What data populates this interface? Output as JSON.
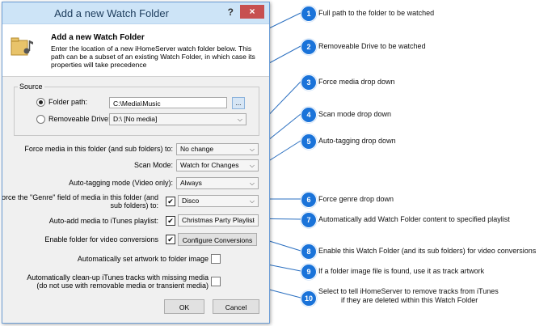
{
  "dialog": {
    "title": "Add a new Watch Folder",
    "help": "?",
    "close": "×",
    "header": {
      "title": "Add a new Watch Folder",
      "description": "Enter the location of a new iHomeServer watch folder below.  This path can be a subset of an existing Watch Folder, in which case its properties will take precedence"
    },
    "source": {
      "group_label": "Source",
      "folder_label": "Folder path:",
      "folder_value": "C:\\Media\\Music",
      "browse_label": "...",
      "removable_label": "Removeable Drive:",
      "removable_value": "D:\\ [No media]"
    },
    "force_media": {
      "label": "Force media in this folder (and sub folders) to:",
      "value": "No change"
    },
    "scan_mode": {
      "label": "Scan Mode:",
      "value": "Watch for Changes"
    },
    "autotag": {
      "label": "Auto-tagging mode (Video only):",
      "value": "Always"
    },
    "genre": {
      "label_line1": "Force the \"Genre\" field of media in this folder (and",
      "label_line2": "sub folders) to:",
      "value": "Disco"
    },
    "playlist": {
      "label": "Auto-add media to iTunes playlist:",
      "value": "Christmas Party Playlist"
    },
    "video": {
      "label": "Enable folder for video conversions",
      "button": "Configure Conversions"
    },
    "artwork": {
      "label": "Automatically set artwork to folder image"
    },
    "cleanup": {
      "label_line1": "Automatically clean-up iTunes tracks with missing media",
      "label_line2": "(do not use with removable media or transient media)"
    },
    "ok": "OK",
    "cancel": "Cancel"
  },
  "callouts": [
    {
      "num": "1",
      "text": "Full path to the folder to be watched"
    },
    {
      "num": "2",
      "text": "Removeable Drive to be watched"
    },
    {
      "num": "3",
      "text": "Force media drop down"
    },
    {
      "num": "4",
      "text": "Scan mode drop down"
    },
    {
      "num": "5",
      "text": "Auto-tagging drop down"
    },
    {
      "num": "6",
      "text": "Force genre drop down"
    },
    {
      "num": "7",
      "text": "Automatically add Watch Folder content to specified playlist"
    },
    {
      "num": "8",
      "text": "Enable this Watch Folder (and its sub folders) for video conversions"
    },
    {
      "num": "9",
      "text": "If a folder image file is found, use it as track artwork"
    },
    {
      "num": "10",
      "text_line1": "Select to tell iHomeServer to remove tracks from iTunes",
      "text_line2": "if they are deleted within this Watch Folder"
    }
  ],
  "colors": {
    "callout": "#1a73d9",
    "close": "#c75050",
    "titlebar": "#cde4f7"
  }
}
